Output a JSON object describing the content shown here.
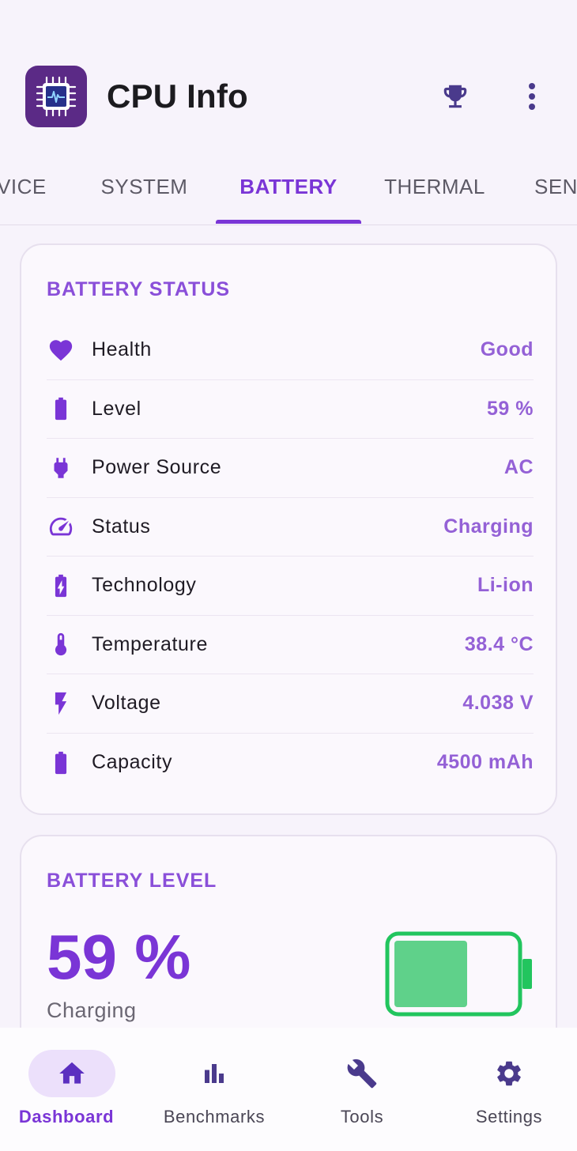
{
  "app": {
    "title": "CPU Info"
  },
  "tabs": [
    {
      "label": "VICE"
    },
    {
      "label": "SYSTEM"
    },
    {
      "label": "BATTERY",
      "active": true
    },
    {
      "label": "THERMAL"
    },
    {
      "label": "SENS"
    }
  ],
  "battery_status": {
    "title": "BATTERY STATUS",
    "rows": [
      {
        "label": "Health",
        "value": "Good",
        "icon": "heart-icon"
      },
      {
        "label": "Level",
        "value": "59 %",
        "icon": "battery-icon"
      },
      {
        "label": "Power Source",
        "value": "AC",
        "icon": "plug-icon"
      },
      {
        "label": "Status",
        "value": "Charging",
        "icon": "speedometer-icon"
      },
      {
        "label": "Technology",
        "value": "Li-ion",
        "icon": "battery-bolt-icon"
      },
      {
        "label": "Temperature",
        "value": "38.4 °C",
        "icon": "thermometer-icon"
      },
      {
        "label": "Voltage",
        "value": "4.038 V",
        "icon": "bolt-icon"
      },
      {
        "label": "Capacity",
        "value": "4500 mAh",
        "icon": "battery-icon"
      }
    ]
  },
  "battery_level": {
    "title": "BATTERY LEVEL",
    "level_text": "59 %",
    "status_text": "Charging",
    "fill_fraction": 0.59
  },
  "bottom_nav": [
    {
      "label": "Dashboard",
      "icon": "home-icon",
      "active": true
    },
    {
      "label": "Benchmarks",
      "icon": "bar-chart-icon"
    },
    {
      "label": "Tools",
      "icon": "wrench-icon"
    },
    {
      "label": "Settings",
      "icon": "gear-icon"
    }
  ],
  "colors": {
    "accent": "#7a35d6",
    "value": "#9461d6",
    "battery_green": "#22c55e",
    "battery_fill": "#5fd18a",
    "logo_bg": "#5b2a86"
  }
}
